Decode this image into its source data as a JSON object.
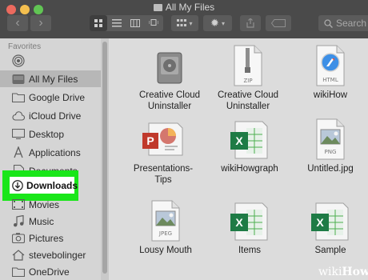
{
  "window": {
    "title": "All My Files"
  },
  "toolbar": {
    "back_glyph": "‹",
    "forward_glyph": "›",
    "search_placeholder": "Search"
  },
  "sidebar": {
    "header": "Favorites",
    "items": [
      {
        "label": "",
        "icon": "airdrop-icon"
      },
      {
        "label": "All My Files",
        "icon": "all-files-icon",
        "selected": true
      },
      {
        "label": "Google Drive",
        "icon": "folder-icon"
      },
      {
        "label": "iCloud Drive",
        "icon": "cloud-icon"
      },
      {
        "label": "Desktop",
        "icon": "desktop-icon"
      },
      {
        "label": "Applications",
        "icon": "applications-icon"
      },
      {
        "label": "Documents",
        "icon": "documents-icon"
      },
      {
        "label": "Downloads",
        "icon": "downloads-icon",
        "highlighted": true
      },
      {
        "label": "Movies",
        "icon": "movies-icon"
      },
      {
        "label": "Music",
        "icon": "music-icon"
      },
      {
        "label": "Pictures",
        "icon": "pictures-icon"
      },
      {
        "label": "stevebolinger",
        "icon": "home-icon"
      },
      {
        "label": "OneDrive",
        "icon": "folder-icon"
      }
    ]
  },
  "files": [
    {
      "name": "Creative Cloud\nUninstaller",
      "type": "app",
      "badge": ""
    },
    {
      "name": "Creative Cloud\nUninstaller",
      "type": "zip",
      "badge": "ZIP"
    },
    {
      "name": "wikiHow",
      "type": "html",
      "badge": "HTML"
    },
    {
      "name": "Presentations-\nTips",
      "type": "ppt",
      "badge": ""
    },
    {
      "name": "wikiHowgraph",
      "type": "xls",
      "badge": ""
    },
    {
      "name": "Untitled.jpg",
      "type": "png",
      "badge": "PNG"
    },
    {
      "name": "Lousy Mouth",
      "type": "jpeg",
      "badge": "JPEG"
    },
    {
      "name": "Items",
      "type": "xls",
      "badge": ""
    },
    {
      "name": "Sample",
      "type": "xls",
      "badge": ""
    }
  ],
  "watermark": {
    "wiki": "wiki",
    "how": "How"
  },
  "colors": {
    "highlight": "#19e619",
    "excel": "#1e7b45",
    "ppt": "#c0392b"
  }
}
